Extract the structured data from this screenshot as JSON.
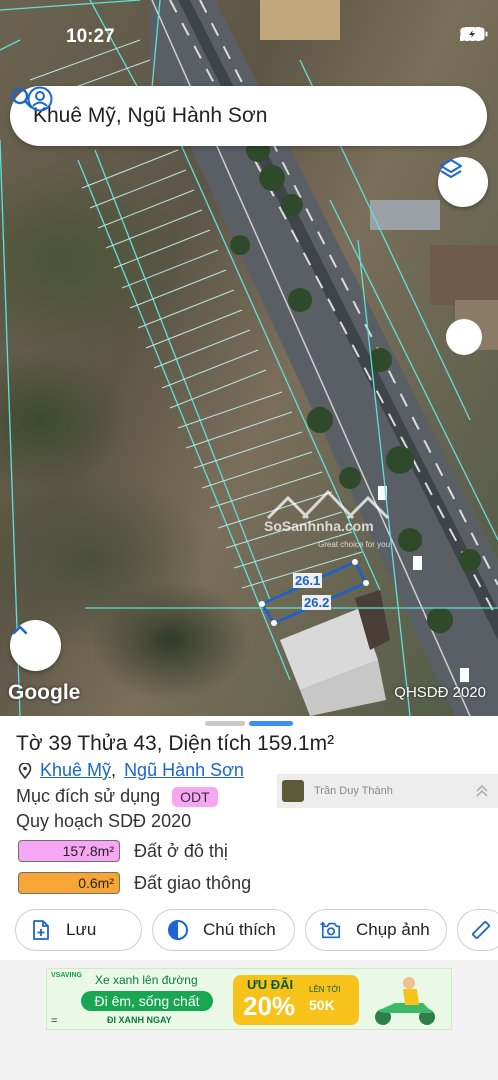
{
  "status_bar": {
    "time": "10:27"
  },
  "search": {
    "query": "Khuê Mỹ, Ngũ Hành Sơn"
  },
  "map": {
    "attribution": "Google",
    "layer_label": "QHSDĐ 2020",
    "plot_edges": [
      "26.1",
      "26.2"
    ],
    "watermark_brand": "SoSanhnha.com",
    "watermark_tagline": "Great choice for you"
  },
  "overlay": {
    "name": "Trần Duy Thành"
  },
  "sheet": {
    "title": "Tờ 39 Thửa 43, Diện tích 159.1m²",
    "ward": "Khuê Mỹ",
    "separator": ",",
    "district": "Ngũ Hành Sơn",
    "purpose_label": "Mục đích sử dụng",
    "purpose_code": "ODT",
    "plan_title": "Quy hoạch SDĐ 2020",
    "legend": [
      {
        "area": "157.8m²",
        "label": "Đất ở đô thị",
        "color": "#f6a6f2"
      },
      {
        "area": "0.6m²",
        "label": "Đất giao thông",
        "color": "#f7a534"
      }
    ],
    "actions": {
      "save": "Lưu",
      "legend": "Chú thích",
      "photo": "Chụp ảnh"
    }
  },
  "ad": {
    "brand": "VSAVING",
    "headline": "Xe xanh lên đường",
    "cta": "Đi êm, sống chất",
    "subline": "ĐI XANH NGAY",
    "promo_label": "ƯU ĐÃI",
    "promo_percent": "20%",
    "promo_cap_label": "LÊN TỚI",
    "promo_cap": "50K",
    "corner": "="
  },
  "colors": {
    "accent": "#1a66d2",
    "plot_outline": "#1a5fd6",
    "planning_lines": "#5fe0d8"
  }
}
